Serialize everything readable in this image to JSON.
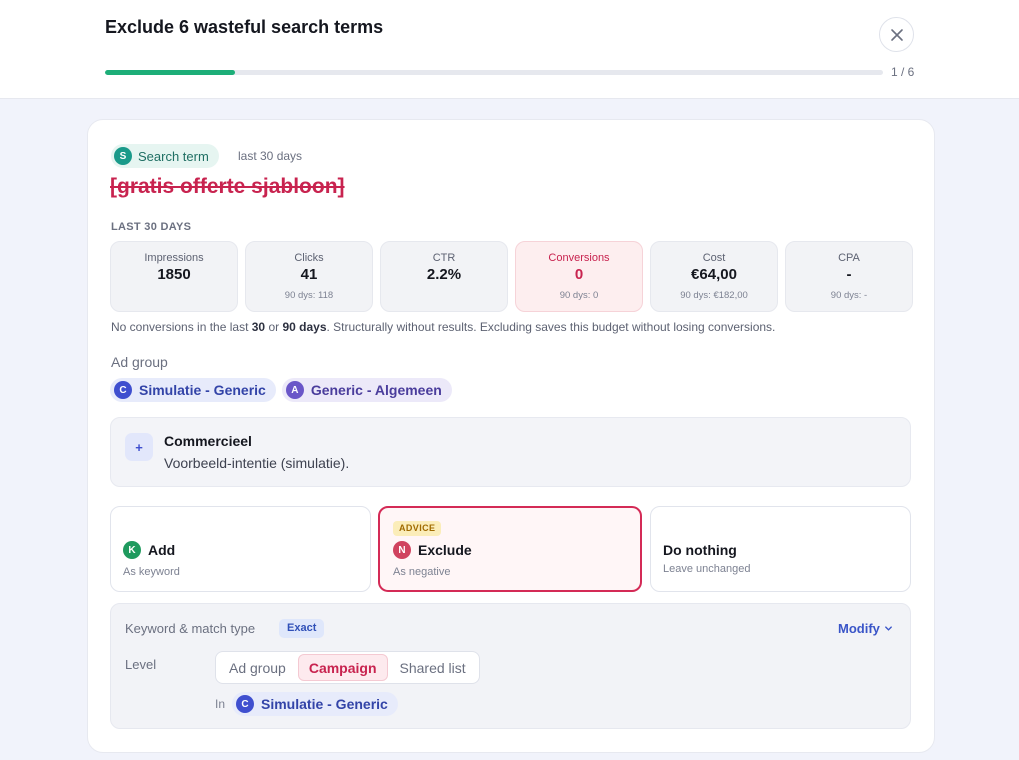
{
  "header": {
    "title": "Exclude 6 wasteful search terms",
    "step": "1 / 6",
    "progress": 0.167
  },
  "term": {
    "type_badge": "S",
    "type_label": "Search term",
    "range": "last 30 days",
    "text": "[gratis offerte sjabloon]"
  },
  "stats": {
    "section_label": "LAST 30 DAYS",
    "items": [
      {
        "label": "Impressions",
        "value": "1850",
        "sub": ""
      },
      {
        "label": "Clicks",
        "value": "41",
        "sub": "90 dys: 118"
      },
      {
        "label": "CTR",
        "value": "2.2%",
        "sub": ""
      },
      {
        "label": "Conversions",
        "value": "0",
        "sub": "90 dys: 0"
      },
      {
        "label": "Cost",
        "value": "€64,00",
        "sub": "90 dys: €182,00"
      },
      {
        "label": "CPA",
        "value": "-",
        "sub": "90 dys: -"
      }
    ],
    "note_prefix": "No conversions in the last ",
    "note_30": "30",
    "note_or": " or ",
    "note_90": "90 days",
    "note_suffix": ". Structurally without results. Excluding saves this budget without losing conversions."
  },
  "adgroups": {
    "label": "Ad group",
    "items": [
      {
        "badge": "C",
        "name": "Simulatie - Generic"
      },
      {
        "badge": "A",
        "name": "Generic - Algemeen"
      }
    ]
  },
  "intent": {
    "icon": "+",
    "title": "Commercieel",
    "description": "Voorbeeld-intentie (simulatie)."
  },
  "options": {
    "add": {
      "badge": "K",
      "title": "Add",
      "sub": "As keyword"
    },
    "exclude": {
      "advice": "ADVICE",
      "badge": "N",
      "title": "Exclude",
      "sub": "As negative"
    },
    "nothing": {
      "title": "Do nothing",
      "sub": "Leave unchanged"
    }
  },
  "keyword": {
    "label": "Keyword & match type",
    "match_type": "Exact",
    "modify": "Modify",
    "level_label": "Level",
    "levels": [
      "Ad group",
      "Campaign",
      "Shared list"
    ],
    "active_level": "Campaign",
    "in_label": "In",
    "in_badge": "C",
    "in_campaign": "Simulatie - Generic"
  },
  "colors": {
    "accent_green": "#1dae78",
    "danger_red": "#c8234f",
    "brand_blue": "#3a55c8",
    "badge_s": "#1a9a8a",
    "badge_c": "#3f4fcf",
    "badge_a": "#6a56c8",
    "badge_k": "#1f9a5e",
    "badge_n": "#d0435f"
  }
}
